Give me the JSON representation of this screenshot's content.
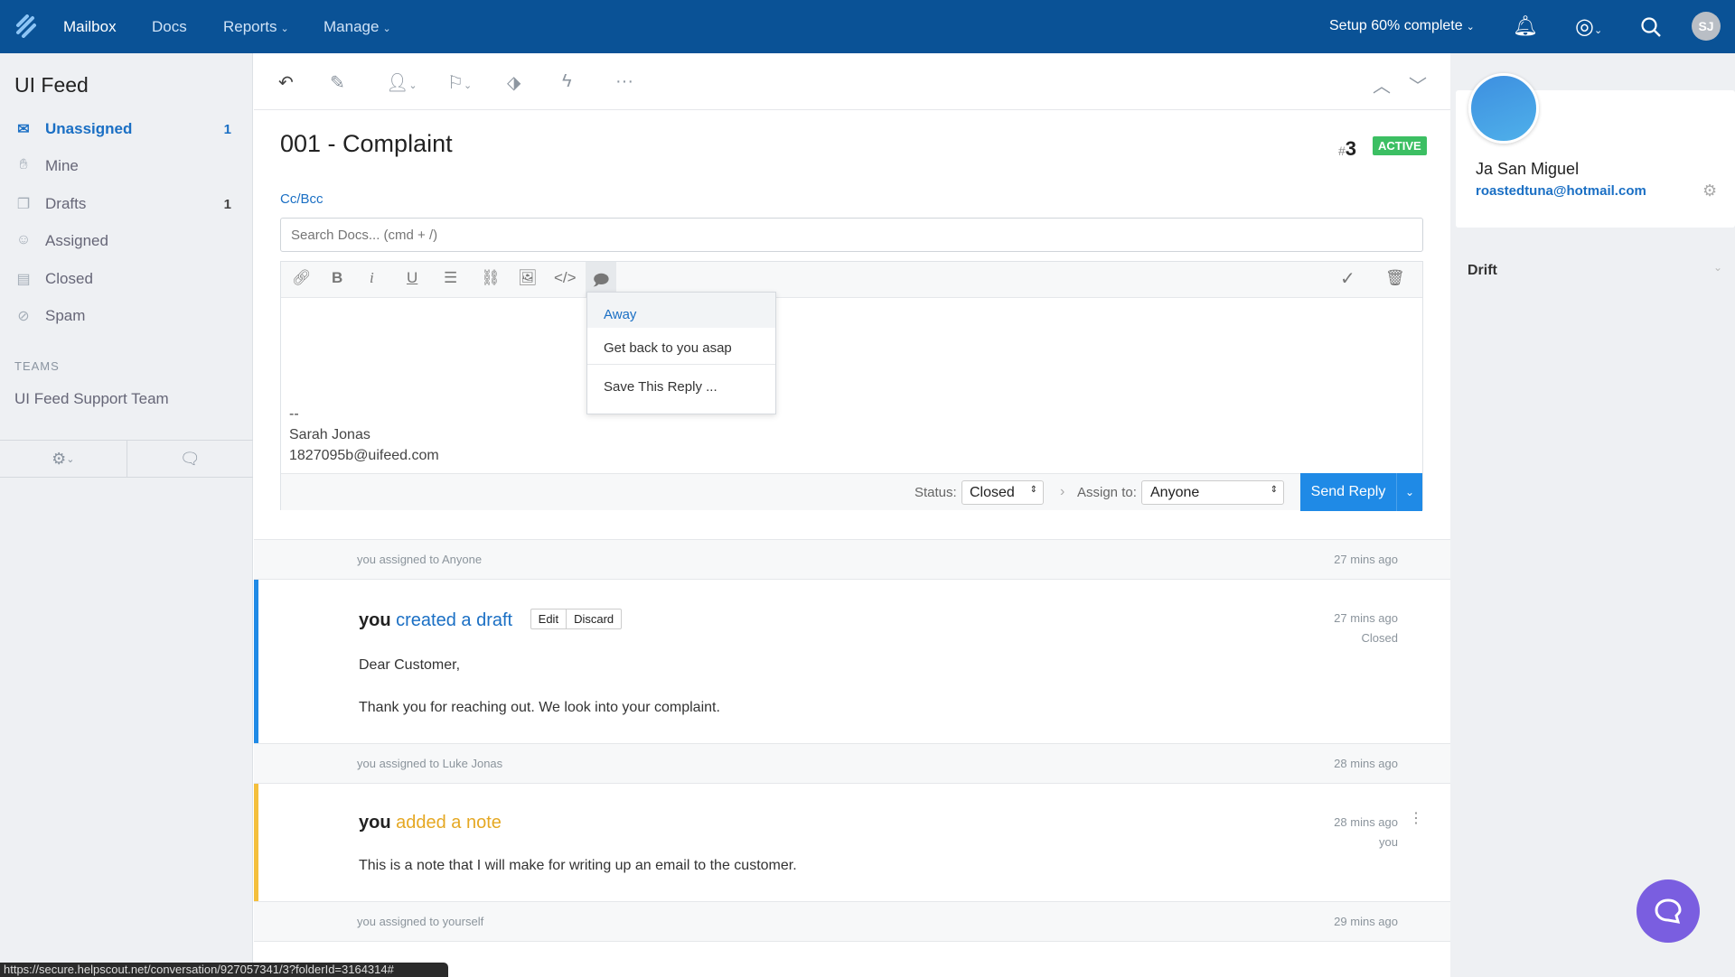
{
  "topbar": {
    "nav": [
      "Mailbox",
      "Docs",
      "Reports",
      "Manage"
    ],
    "setup": "Setup 60% complete",
    "avatar": "SJ",
    "brand_color": "#0a5296"
  },
  "sidebar": {
    "title": "UI Feed",
    "items": [
      {
        "label": "Unassigned",
        "count": "1",
        "icon": "inbox-icon"
      },
      {
        "label": "Mine",
        "count": "",
        "icon": "hand-icon"
      },
      {
        "label": "Drafts",
        "count": "1",
        "icon": "drafts-icon"
      },
      {
        "label": "Assigned",
        "count": "",
        "icon": "person-icon"
      },
      {
        "label": "Closed",
        "count": "",
        "icon": "archive-icon"
      },
      {
        "label": "Spam",
        "count": "",
        "icon": "ban-icon"
      }
    ],
    "teams_heading": "TEAMS",
    "teams": [
      "UI Feed Support Team"
    ]
  },
  "conversation": {
    "title": "001 - Complaint",
    "number_prefix": "#",
    "number": "3",
    "status_badge": "ACTIVE",
    "cc_bcc": "Cc/Bcc",
    "search_placeholder": "Search Docs... (cmd + /)",
    "signature": [
      "--",
      "Sarah Jonas",
      "1827095b@uifeed.com"
    ],
    "saved_replies": [
      "Away",
      "Get back to you asap",
      "Save This Reply ..."
    ],
    "status_label": "Status:",
    "status_value": "Closed",
    "assign_label": "Assign to:",
    "assign_value": "Anyone",
    "send_label": "Send Reply"
  },
  "timeline": [
    {
      "type": "event",
      "text": "you assigned to Anyone",
      "time": "27 mins ago"
    },
    {
      "type": "draft",
      "who": "you",
      "action": "created a draft",
      "edit": "Edit",
      "discard": "Discard",
      "time": "27 mins ago",
      "status": "Closed",
      "body": [
        "Dear Customer,",
        "Thank you for reaching out. We look into your complaint."
      ]
    },
    {
      "type": "event",
      "text": "you assigned to Luke Jonas",
      "time": "28 mins ago"
    },
    {
      "type": "note",
      "who": "you",
      "action": "added a note",
      "time": "28 mins ago",
      "by": "you",
      "body": [
        "This is a note that I will make for writing up an email to the customer."
      ]
    },
    {
      "type": "event",
      "text": "you assigned to yourself",
      "time": "29 mins ago"
    }
  ],
  "customer": {
    "name": "Ja San Miguel",
    "email": "roastedtuna@hotmail.com",
    "app": "Drift"
  },
  "statusbar": {
    "url": "https://secure.helpscout.net/conversation/927057341/3?folderId=3164314#"
  }
}
